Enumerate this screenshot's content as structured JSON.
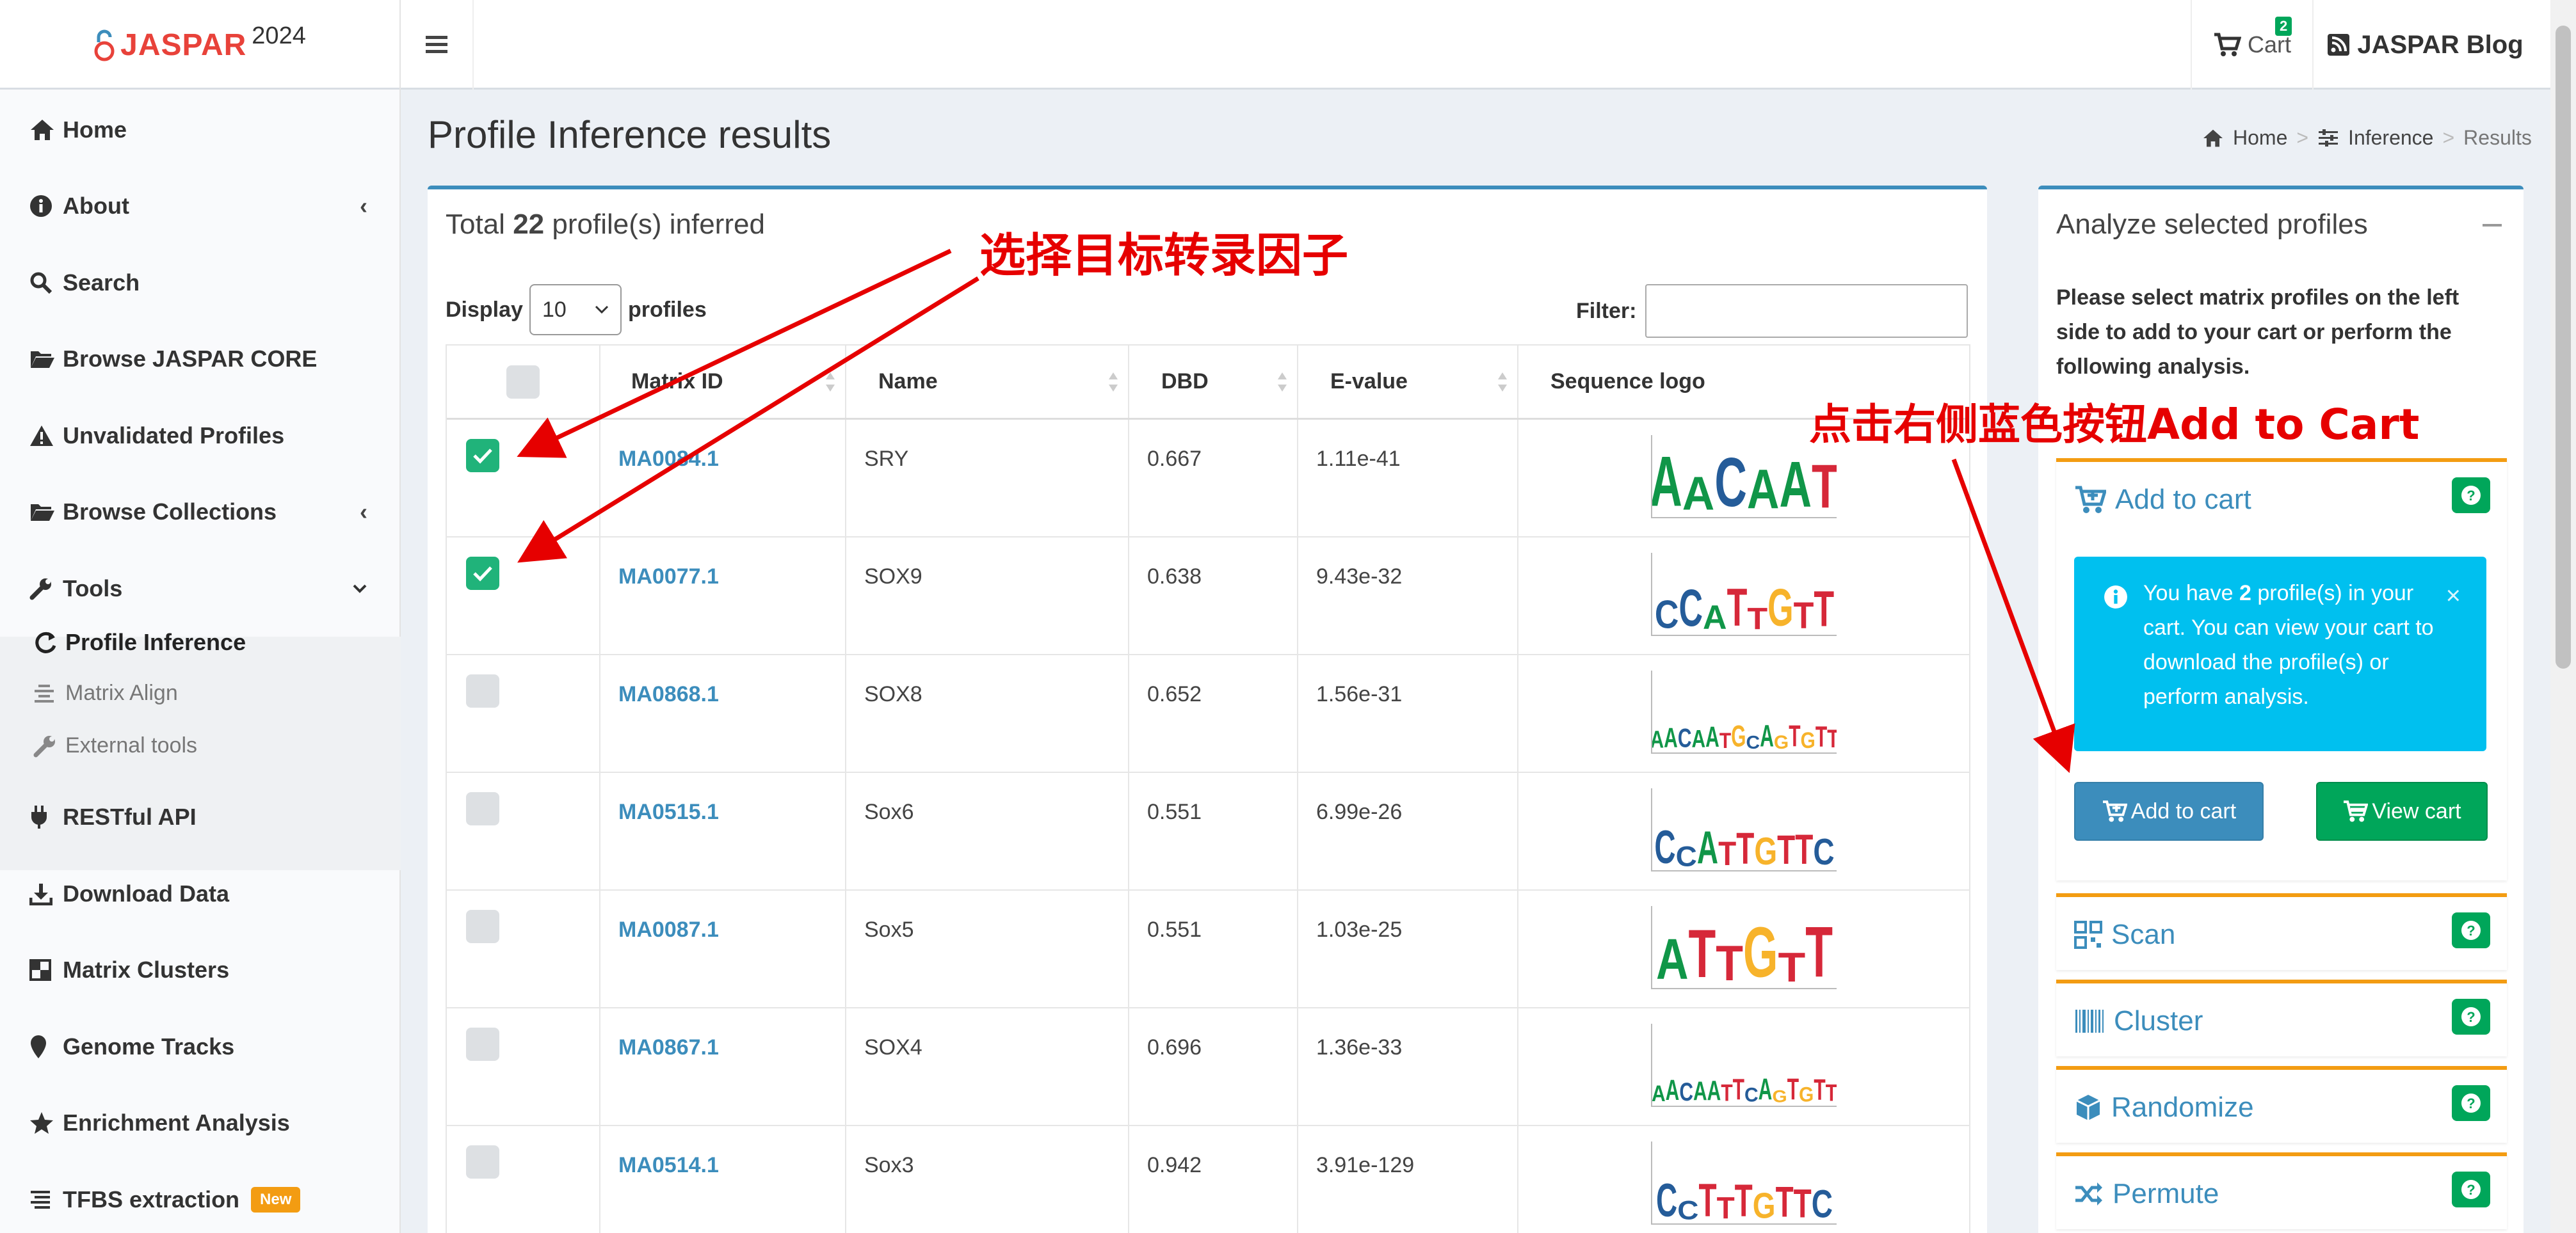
{
  "brand": {
    "name": "JASPAR",
    "year": "2024"
  },
  "topnav": {
    "cart_label": "Cart",
    "cart_count": "2",
    "blog_label": "JASPAR Blog"
  },
  "sidebar": {
    "items": [
      {
        "label": "Home",
        "icon": "home-icon"
      },
      {
        "label": "About",
        "icon": "info-icon"
      },
      {
        "label": "Search",
        "icon": "search-icon"
      },
      {
        "label": "Browse JASPAR CORE",
        "icon": "folder-icon"
      },
      {
        "label": "Unvalidated Profiles",
        "icon": "warning-icon"
      },
      {
        "label": "Browse Collections",
        "icon": "folder-icon"
      },
      {
        "label": "Tools",
        "icon": "wrench-icon"
      },
      {
        "label": "RESTful API",
        "icon": "plug-icon"
      },
      {
        "label": "Download Data",
        "icon": "download-icon"
      },
      {
        "label": "Matrix Clusters",
        "icon": "clusters-icon"
      },
      {
        "label": "Genome Tracks",
        "icon": "map-marker-icon"
      },
      {
        "label": "Enrichment Analysis",
        "icon": "star-icon"
      },
      {
        "label": "TFBS extraction",
        "icon": "list-icon"
      }
    ],
    "tools_sub": [
      {
        "label": "Profile Inference",
        "icon": "refresh-icon"
      },
      {
        "label": "Matrix Align",
        "icon": "align-icon"
      },
      {
        "label": "External tools",
        "icon": "wrench-icon"
      }
    ],
    "new_badge": "New"
  },
  "page": {
    "title": "Profile Inference results"
  },
  "breadcrumb": {
    "home": "Home",
    "inference": "Inference",
    "current": "Results",
    "sep": ">"
  },
  "results": {
    "total_prefix": "Total",
    "total_count": "22",
    "total_suffix": "profile(s) inferred",
    "display_label": "Display",
    "display_value": "10",
    "profiles_label": "profiles",
    "filter_label": "Filter:",
    "filter_value": "",
    "columns": [
      "Matrix ID",
      "Name",
      "DBD",
      "E-value",
      "Sequence logo"
    ],
    "rows": [
      {
        "checked": true,
        "matrix_id": "MA0084.1",
        "name": "SRY",
        "dbd": "0.667",
        "evalue": "1.11e-41",
        "logo": "AACAAT"
      },
      {
        "checked": true,
        "matrix_id": "MA0077.1",
        "name": "SOX9",
        "dbd": "0.638",
        "evalue": "9.43e-32",
        "logo": "CCATTGTT"
      },
      {
        "checked": false,
        "matrix_id": "MA0868.1",
        "name": "SOX8",
        "dbd": "0.652",
        "evalue": "1.56e-31",
        "logo": "AACAATGCAGTGTT"
      },
      {
        "checked": false,
        "matrix_id": "MA0515.1",
        "name": "Sox6",
        "dbd": "0.551",
        "evalue": "6.99e-26",
        "logo": "CCATTGTTC"
      },
      {
        "checked": false,
        "matrix_id": "MA0087.1",
        "name": "Sox5",
        "dbd": "0.551",
        "evalue": "1.03e-25",
        "logo": "ATTGTT"
      },
      {
        "checked": false,
        "matrix_id": "MA0867.1",
        "name": "SOX4",
        "dbd": "0.696",
        "evalue": "1.36e-33",
        "logo": "AACAATTCAGTGTT"
      },
      {
        "checked": false,
        "matrix_id": "MA0514.1",
        "name": "Sox3",
        "dbd": "0.942",
        "evalue": "3.91e-129",
        "logo": "CCTTTGTTC"
      }
    ]
  },
  "analyze": {
    "title": "Analyze selected profiles",
    "description": "Please select matrix profiles on the left side to add to your cart or perform the following analysis.",
    "add_to_cart_title": "Add to cart",
    "alert_prefix": "You have",
    "alert_count": "2",
    "alert_suffix": "profile(s) in your cart. You can view your cart to download the profile(s) or perform analysis.",
    "add_button": "Add to cart",
    "view_button": "View cart",
    "tools": [
      "Scan",
      "Cluster",
      "Randomize",
      "Permute"
    ]
  },
  "annotations": {
    "select_tf": "选择目标转录因子",
    "click_add": "点击右侧蓝色按钮Add to Cart"
  },
  "colors": {
    "accent": "#3c8dbc",
    "brand_red": "#e8423a",
    "success": "#00a65a",
    "info": "#00c0ef",
    "warning": "#f39c12",
    "annotation": "#e60000"
  }
}
